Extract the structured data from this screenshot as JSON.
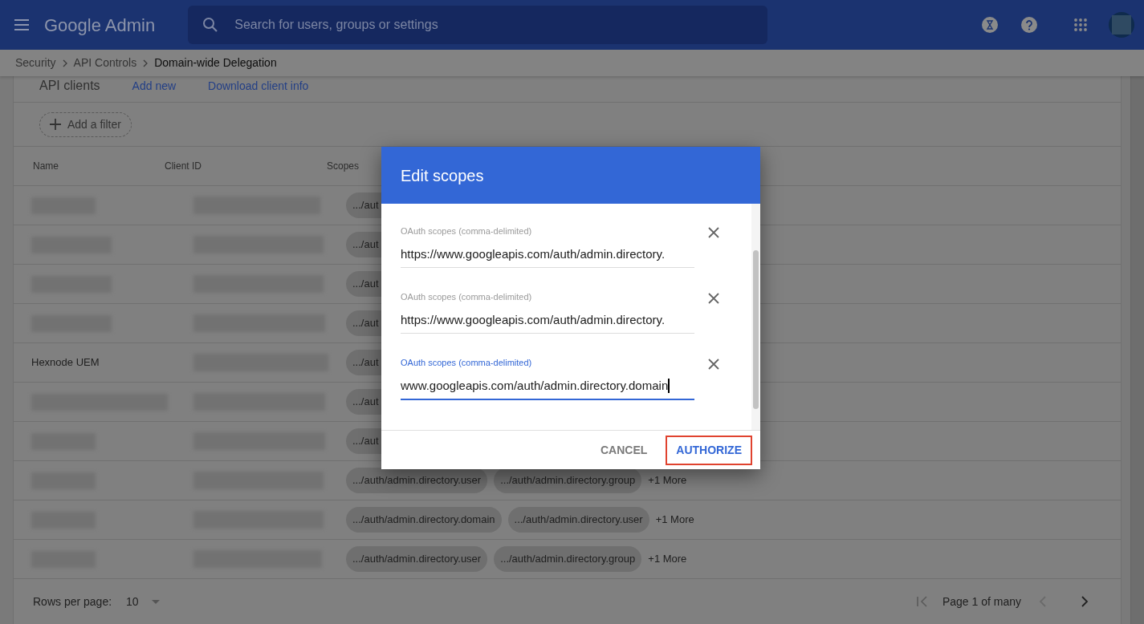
{
  "app_bar": {
    "logo": "Google Admin",
    "search": {
      "placeholder": "Search for users, groups or settings"
    }
  },
  "breadcrumb": [
    {
      "label": "Security",
      "current": false
    },
    {
      "label": "API Controls",
      "current": false
    },
    {
      "label": "Domain-wide Delegation",
      "current": true
    }
  ],
  "section": {
    "title": "API clients",
    "links": [
      "Add new",
      "Download client info"
    ]
  },
  "filter": {
    "label": "Add a filter"
  },
  "table": {
    "columns": [
      "Name",
      "Client ID",
      "Scopes"
    ],
    "rows": [
      {
        "name": {
          "kind": "redacted"
        },
        "scopes": [
          ".../aut"
        ]
      },
      {
        "name": {
          "kind": "redacted"
        },
        "scopes": [
          ".../aut"
        ]
      },
      {
        "name": {
          "kind": "redacted"
        },
        "scopes": [
          ".../aut"
        ]
      },
      {
        "name": {
          "kind": "redacted"
        },
        "scopes": [
          ".../aut"
        ]
      },
      {
        "name": {
          "kind": "text",
          "text": "Hexnode UEM"
        },
        "scopes": [
          ".../aut"
        ]
      },
      {
        "name": {
          "kind": "redacted"
        },
        "scopes": [
          ".../aut"
        ]
      },
      {
        "name": {
          "kind": "redacted"
        },
        "scopes": [
          ".../aut"
        ]
      },
      {
        "name": {
          "kind": "redacted"
        },
        "scopes": [
          ".../auth/admin.directory.user",
          ".../auth/admin.directory.group"
        ],
        "more": "+1 More"
      },
      {
        "name": {
          "kind": "redacted"
        },
        "scopes": [
          ".../auth/admin.directory.domain",
          ".../auth/admin.directory.user"
        ],
        "more": "+1 More"
      },
      {
        "name": {
          "kind": "redacted"
        },
        "scopes": [
          ".../auth/admin.directory.user",
          ".../auth/admin.directory.group"
        ],
        "more": "+1 More"
      }
    ]
  },
  "pagination": {
    "rows_label": "Rows per page:",
    "rows_value": "10",
    "page_label": "Page 1 of many",
    "prev_disabled": true,
    "next_disabled": false
  },
  "dialog": {
    "title": "Edit scopes",
    "fields": [
      {
        "label": "OAuth scopes (comma-delimited)",
        "value": "https://www.googleapis.com/auth/admin.directory.",
        "focused": false
      },
      {
        "label": "OAuth scopes (comma-delimited)",
        "value": "https://www.googleapis.com/auth/admin.directory.",
        "focused": false
      },
      {
        "label": "OAuth scopes (comma-delimited)",
        "value": "www.googleapis.com/auth/admin.directory.domain",
        "focused": true
      }
    ],
    "buttons": [
      {
        "label": "CANCEL",
        "primary": false,
        "highlighted": false
      },
      {
        "label": "AUTHORIZE",
        "primary": true,
        "highlighted": true
      }
    ]
  }
}
